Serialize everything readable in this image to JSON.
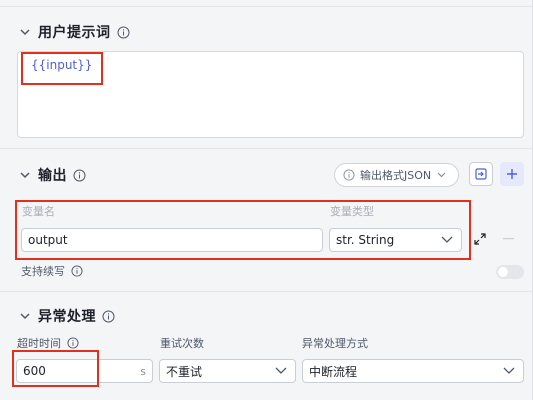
{
  "user_prompt": {
    "title": "用户提示词",
    "content": "{{input}}"
  },
  "output": {
    "title": "输出",
    "format_button": "输出格式JSON",
    "col_name_label": "变量名",
    "col_type_label": "变量类型",
    "variable_name": "output",
    "variable_type": "str. String",
    "streaming_label": "支持续写",
    "streaming_enabled": false
  },
  "error_handling": {
    "title": "异常处理",
    "timeout_label": "超时时间",
    "timeout_value": "600",
    "timeout_unit": "s",
    "retry_label": "重试次数",
    "retry_value": "不重试",
    "method_label": "异常处理方式",
    "method_value": "中断流程"
  },
  "colors": {
    "accent": "#4e5fd8",
    "highlight_box": "#e0301e",
    "toggle_off": "#e5e6eb"
  },
  "icons": [
    "chevron-down-icon",
    "info-icon",
    "expand-icon",
    "minus-icon",
    "plus-icon",
    "import-icon"
  ]
}
